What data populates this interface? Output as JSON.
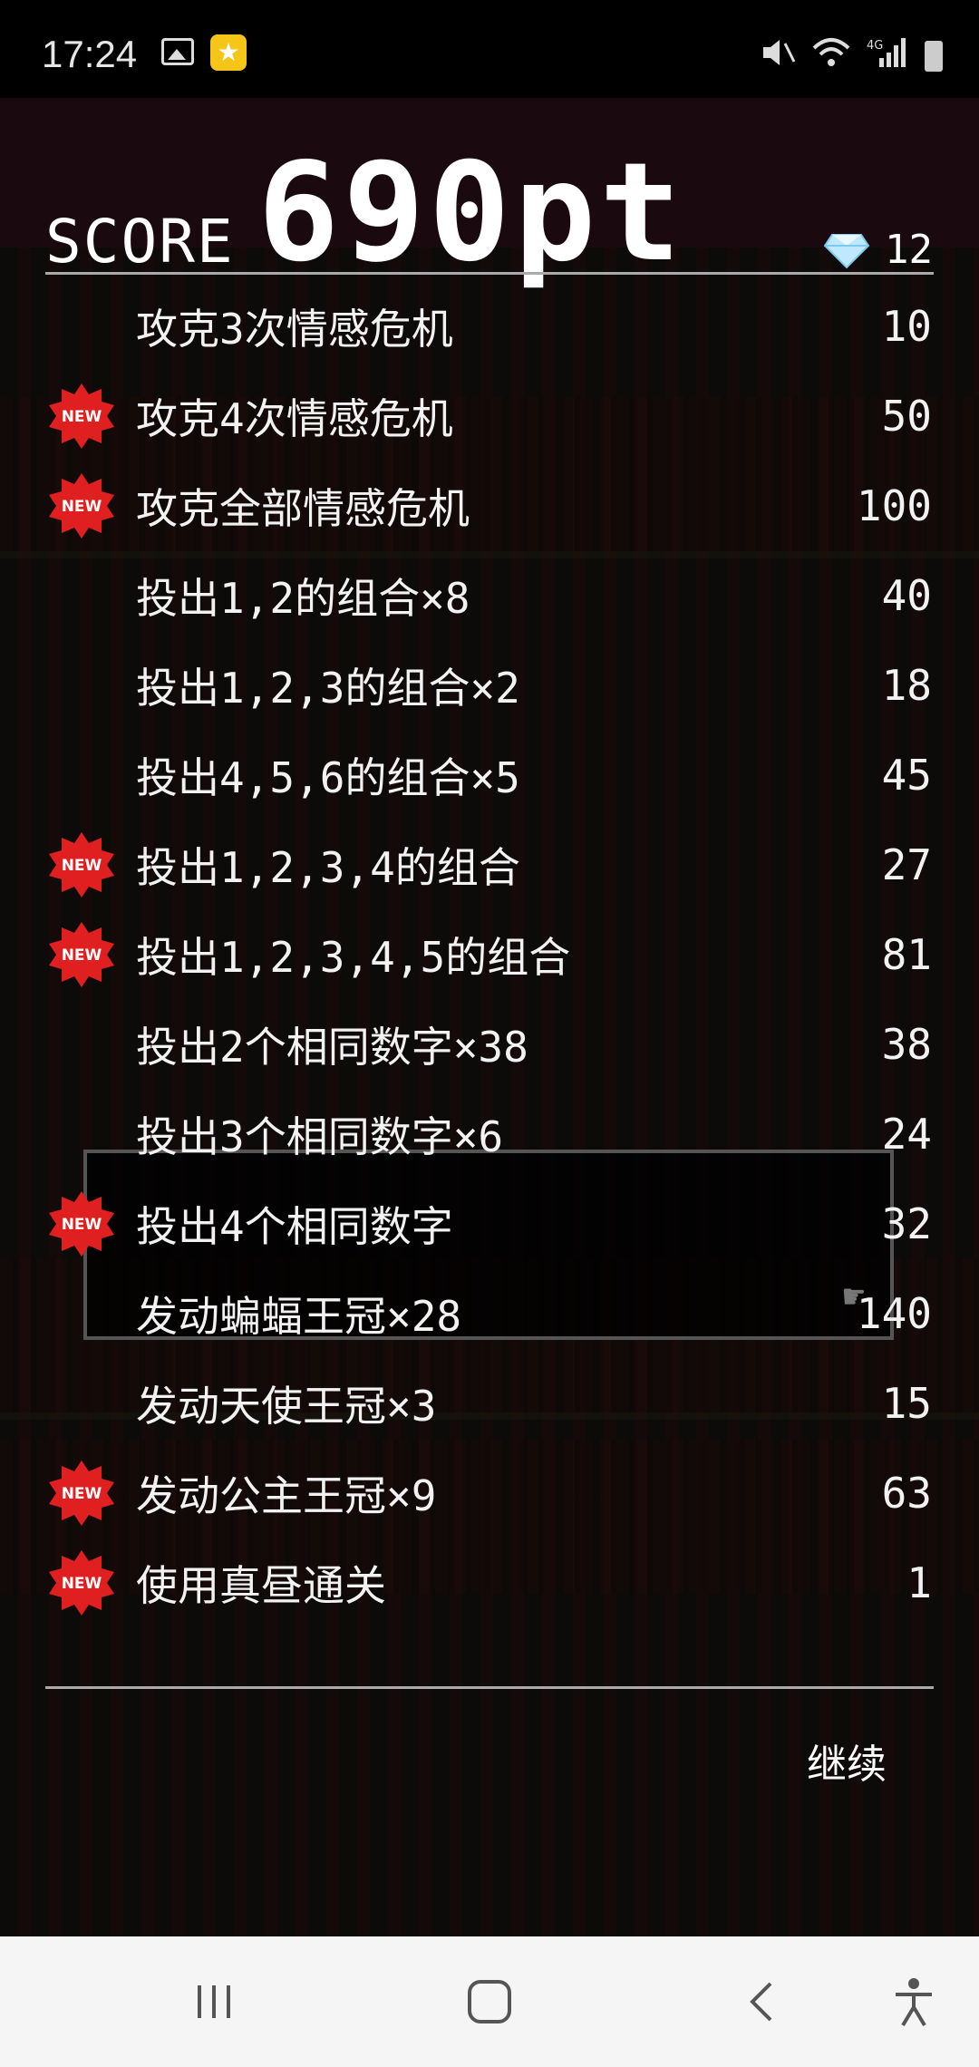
{
  "status_bar": {
    "time": "17:24",
    "left_icons": [
      "gallery-icon",
      "star-app-icon"
    ],
    "right_icons": [
      "mute-icon",
      "wifi-icon",
      "4g-signal-icon",
      "battery-icon"
    ],
    "network_label": "4G"
  },
  "header": {
    "score_label": "SCORE",
    "score_value": "690pt",
    "gems": "12"
  },
  "achievements": [
    {
      "label": "攻克3次情感危机",
      "points": "10",
      "is_new": false
    },
    {
      "label": "攻克4次情感危机",
      "points": "50",
      "is_new": true
    },
    {
      "label": "攻克全部情感危机",
      "points": "100",
      "is_new": true
    },
    {
      "label": "投出1,2的组合×8",
      "points": "40",
      "is_new": false
    },
    {
      "label": "投出1,2,3的组合×2",
      "points": "18",
      "is_new": false
    },
    {
      "label": "投出4,5,6的组合×5",
      "points": "45",
      "is_new": false
    },
    {
      "label": "投出1,2,3,4的组合",
      "points": "27",
      "is_new": true
    },
    {
      "label": "投出1,2,3,4,5的组合",
      "points": "81",
      "is_new": true
    },
    {
      "label": "投出2个相同数字×38",
      "points": "38",
      "is_new": false
    },
    {
      "label": "投出3个相同数字×6",
      "points": "24",
      "is_new": false
    },
    {
      "label": "投出4个相同数字",
      "points": "32",
      "is_new": true
    },
    {
      "label": "发动蝙蝠王冠×28",
      "points": "140",
      "is_new": false
    },
    {
      "label": "发动天使王冠×3",
      "points": "15",
      "is_new": false
    },
    {
      "label": "发动公主王冠×9",
      "points": "63",
      "is_new": true
    },
    {
      "label": "使用真昼通关",
      "points": "1",
      "is_new": true
    }
  ],
  "new_badge_text": "NEW",
  "continue_label": "继续",
  "nav_bar": {
    "recent_icon": "recent-apps-icon",
    "home_icon": "home-icon",
    "back_icon": "back-icon",
    "accessibility_icon": "accessibility-icon"
  },
  "colors": {
    "badge_red": "#e02020",
    "background": "#1a1712",
    "status_bar": "#000000",
    "nav_bar": "#f5f5f5"
  }
}
